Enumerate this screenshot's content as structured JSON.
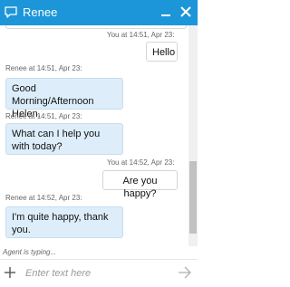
{
  "header": {
    "title": "Renee",
    "color": "#1c96d8"
  },
  "messages": [
    {
      "sender": "user",
      "meta": "You at 14:51, Apr 23:",
      "text": "Hello"
    },
    {
      "sender": "agent",
      "meta": "Renee at 14:51, Apr 23:",
      "text": "Good Morning/Afternoon Helen."
    },
    {
      "sender": "agent",
      "meta": "Renee at 14:51, Apr 23:",
      "text": "What can I help you with today?"
    },
    {
      "sender": "user",
      "meta": "You at 14:52, Apr 23:",
      "text": "Are you happy?"
    },
    {
      "sender": "agent",
      "meta": "Renee at 14:52, Apr 23:",
      "text": "I'm quite happy, thank you."
    }
  ],
  "status": {
    "typing": "Agent is typing..."
  },
  "composer": {
    "placeholder": "Enter text here",
    "value": ""
  },
  "icons": {
    "header_left": "chat-bubble-icon",
    "minimize": "minimize-icon",
    "close": "close-icon",
    "attach": "plus-icon",
    "send": "send-arrow-icon"
  }
}
